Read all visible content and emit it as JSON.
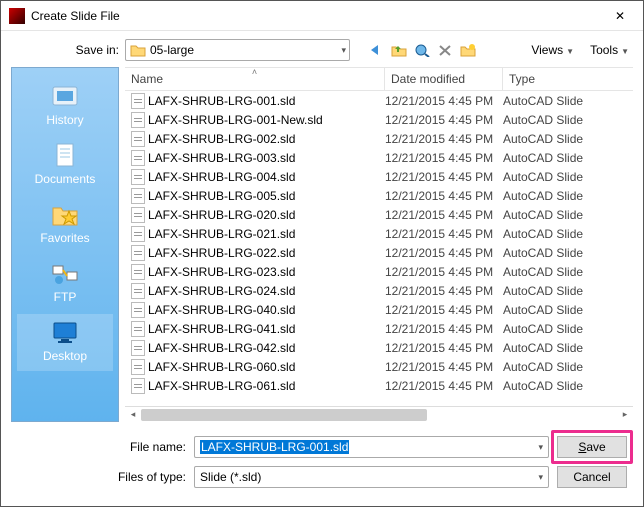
{
  "window": {
    "title": "Create Slide File",
    "close": "✕"
  },
  "save_in": {
    "label": "Save in:",
    "value": "05-large"
  },
  "menus": {
    "views": "Views",
    "tools": "Tools"
  },
  "columns": {
    "name": "Name",
    "date": "Date modified",
    "type": "Type"
  },
  "places": {
    "history": "History",
    "documents": "Documents",
    "favorites": "Favorites",
    "ftp": "FTP",
    "desktop": "Desktop"
  },
  "files": [
    {
      "name": "LAFX-SHRUB-LRG-001.sld",
      "date": "12/21/2015 4:45 PM",
      "type": "AutoCAD Slide"
    },
    {
      "name": "LAFX-SHRUB-LRG-001-New.sld",
      "date": "12/21/2015 4:45 PM",
      "type": "AutoCAD Slide"
    },
    {
      "name": "LAFX-SHRUB-LRG-002.sld",
      "date": "12/21/2015 4:45 PM",
      "type": "AutoCAD Slide"
    },
    {
      "name": "LAFX-SHRUB-LRG-003.sld",
      "date": "12/21/2015 4:45 PM",
      "type": "AutoCAD Slide"
    },
    {
      "name": "LAFX-SHRUB-LRG-004.sld",
      "date": "12/21/2015 4:45 PM",
      "type": "AutoCAD Slide"
    },
    {
      "name": "LAFX-SHRUB-LRG-005.sld",
      "date": "12/21/2015 4:45 PM",
      "type": "AutoCAD Slide"
    },
    {
      "name": "LAFX-SHRUB-LRG-020.sld",
      "date": "12/21/2015 4:45 PM",
      "type": "AutoCAD Slide"
    },
    {
      "name": "LAFX-SHRUB-LRG-021.sld",
      "date": "12/21/2015 4:45 PM",
      "type": "AutoCAD Slide"
    },
    {
      "name": "LAFX-SHRUB-LRG-022.sld",
      "date": "12/21/2015 4:45 PM",
      "type": "AutoCAD Slide"
    },
    {
      "name": "LAFX-SHRUB-LRG-023.sld",
      "date": "12/21/2015 4:45 PM",
      "type": "AutoCAD Slide"
    },
    {
      "name": "LAFX-SHRUB-LRG-024.sld",
      "date": "12/21/2015 4:45 PM",
      "type": "AutoCAD Slide"
    },
    {
      "name": "LAFX-SHRUB-LRG-040.sld",
      "date": "12/21/2015 4:45 PM",
      "type": "AutoCAD Slide"
    },
    {
      "name": "LAFX-SHRUB-LRG-041.sld",
      "date": "12/21/2015 4:45 PM",
      "type": "AutoCAD Slide"
    },
    {
      "name": "LAFX-SHRUB-LRG-042.sld",
      "date": "12/21/2015 4:45 PM",
      "type": "AutoCAD Slide"
    },
    {
      "name": "LAFX-SHRUB-LRG-060.sld",
      "date": "12/21/2015 4:45 PM",
      "type": "AutoCAD Slide"
    },
    {
      "name": "LAFX-SHRUB-LRG-061.sld",
      "date": "12/21/2015 4:45 PM",
      "type": "AutoCAD Slide"
    }
  ],
  "filename": {
    "label": "File name:",
    "value": "LAFX-SHRUB-LRG-001.sld"
  },
  "filetype": {
    "label": "Files of type:",
    "value": "Slide (*.sld)"
  },
  "buttons": {
    "save": "Save",
    "cancel": "Cancel"
  }
}
